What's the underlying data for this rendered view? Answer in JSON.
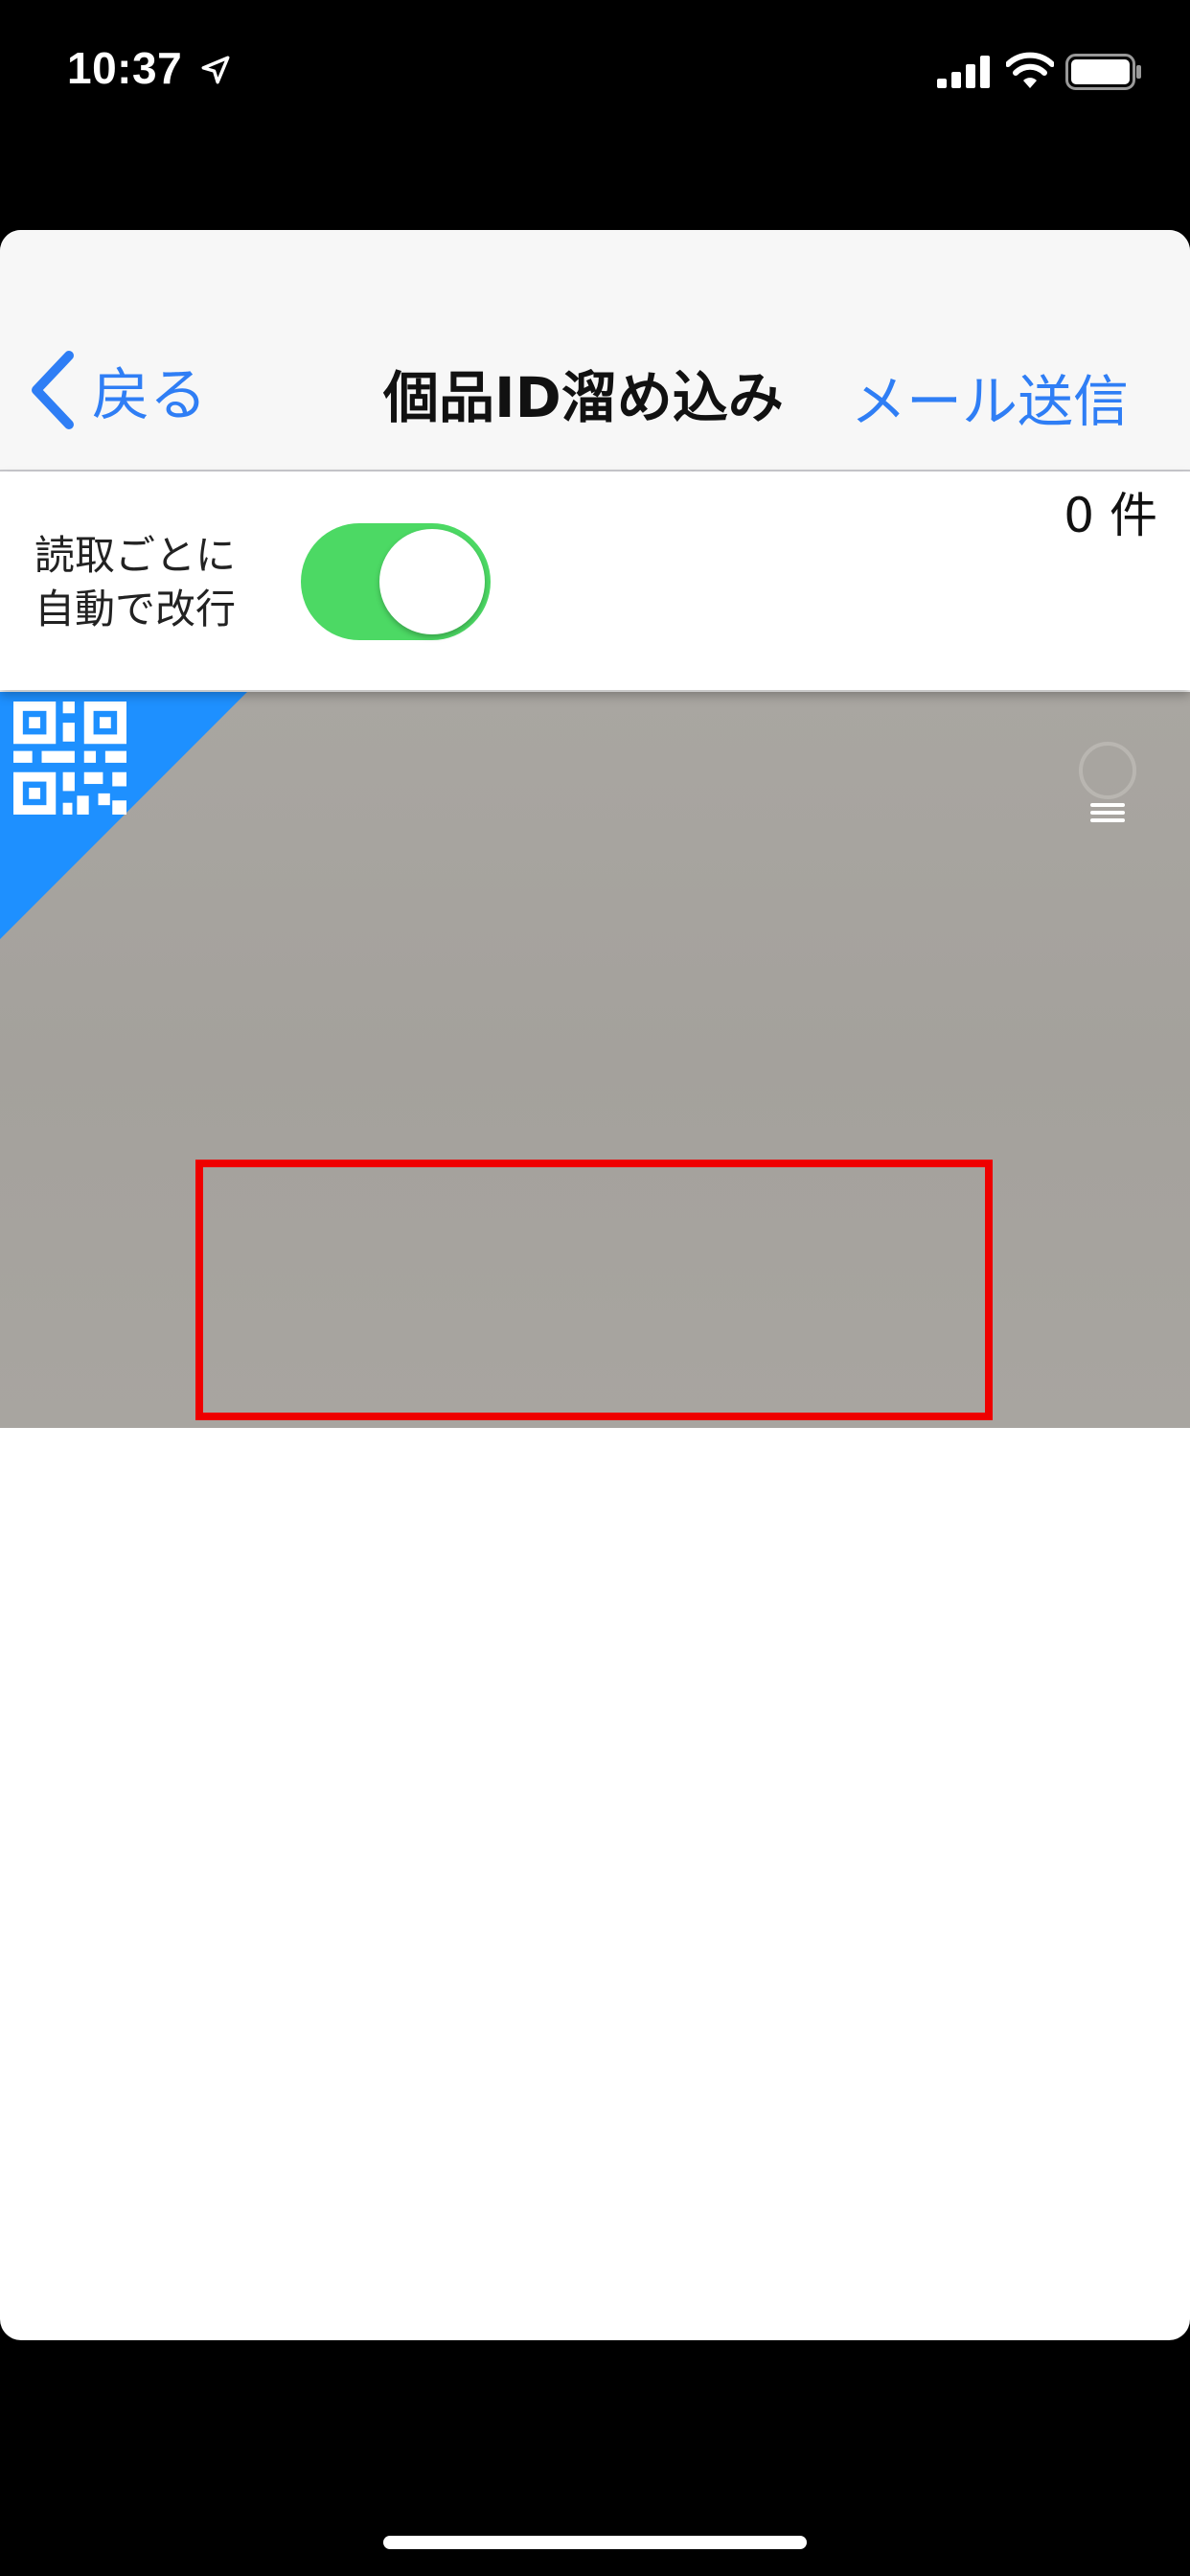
{
  "status_bar": {
    "time": "10:37",
    "icons": [
      "location-arrow-icon",
      "signal-bars-icon",
      "wifi-icon",
      "battery-icon"
    ]
  },
  "nav": {
    "back_label": "戻る",
    "title": "個品ID溜め込み",
    "right_label": "メール送信"
  },
  "settings": {
    "auto_newline_label_line1": "読取ごとに",
    "auto_newline_label_line2": "自動で改行",
    "auto_newline_enabled": true,
    "count_text": "0 件"
  },
  "camera": {
    "corner_badge_icon": "qr-code-icon",
    "light_icon": "lightbulb-icon"
  },
  "colors": {
    "accent": "#2f7ef5",
    "toggle_on": "#4cd964",
    "scan_frame": "#ee0000",
    "corner_badge": "#1e90ff",
    "camera_bg": "#a6a39e"
  }
}
